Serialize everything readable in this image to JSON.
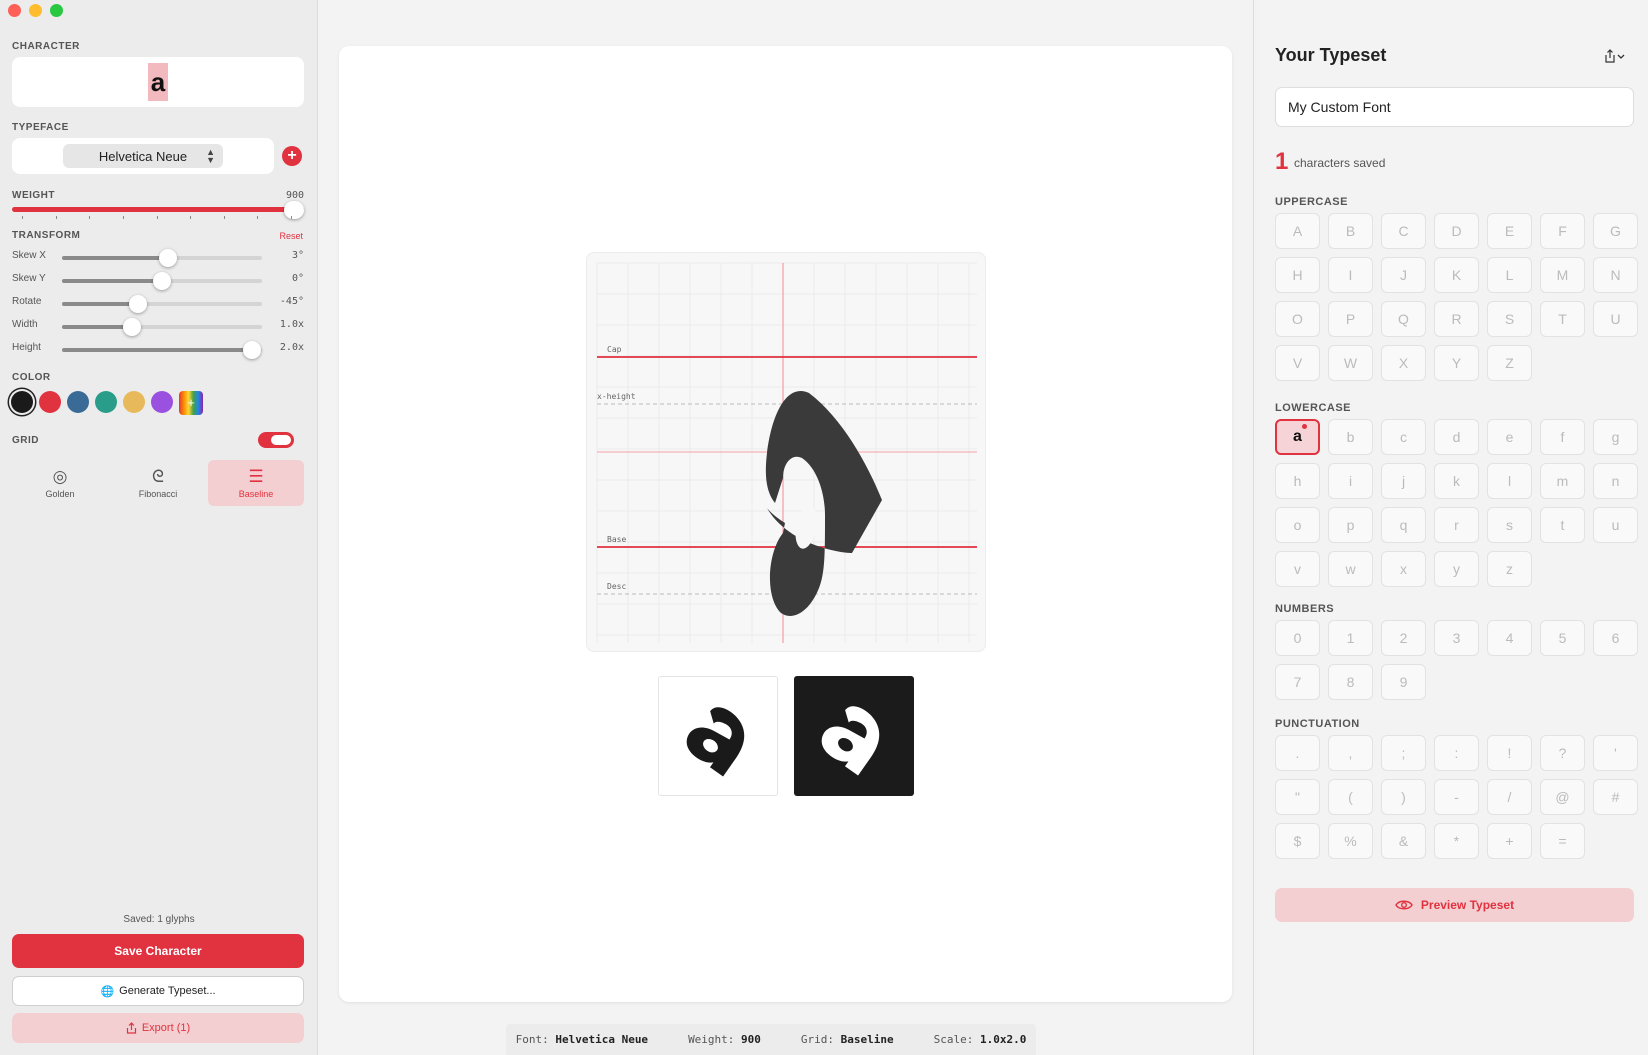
{
  "sidebar": {
    "character_label": "CHARACTER",
    "character": "a",
    "typeface_label": "TYPEFACE",
    "typeface": "Helvetica Neue",
    "add_typeface": "+",
    "weight_label": "WEIGHT",
    "weight_value": "900",
    "transform_label": "TRANSFORM",
    "reset_label": "Reset",
    "sliders": [
      {
        "label": "Skew X",
        "value": "3°",
        "fraction": 0.53
      },
      {
        "label": "Skew Y",
        "value": "0°",
        "fraction": 0.5
      },
      {
        "label": "Rotate",
        "value": "-45°",
        "fraction": 0.38
      },
      {
        "label": "Width",
        "value": "1.0x",
        "fraction": 0.35
      },
      {
        "label": "Height",
        "value": "2.0x",
        "fraction": 0.95
      }
    ],
    "color_label": "COLOR",
    "colors": [
      "#1a1a1a",
      "#e0323f",
      "#3a6b96",
      "#2a9d8a",
      "#e8b95a",
      "#9b51e0"
    ],
    "color_custom": "+",
    "grid_label": "GRID",
    "grid_enabled": true,
    "grid_options": [
      {
        "label": "Golden",
        "icon": "golden-ratio-icon",
        "glyph": "◎",
        "active": false
      },
      {
        "label": "Fibonacci",
        "icon": "fibonacci-spiral-icon",
        "glyph": "ᘓ",
        "active": false
      },
      {
        "label": "Baseline",
        "icon": "baseline-lines-icon",
        "glyph": "☰",
        "active": true
      }
    ],
    "saved_count": "Saved: 1 glyphs",
    "save_button": "Save Character",
    "generate_button": "Generate Typeset...",
    "export_button": "Export (1)"
  },
  "canvas": {
    "guides": {
      "cap": "Cap",
      "xheight": "x-height",
      "base": "Base",
      "desc": "Desc"
    }
  },
  "status": {
    "font_label": "Font:",
    "font": "Helvetica Neue",
    "weight_label": "Weight:",
    "weight": "900",
    "grid_label": "Grid:",
    "grid": "Baseline",
    "scale_label": "Scale:",
    "scale": "1.0x2.0"
  },
  "typeset": {
    "title": "Your Typeset",
    "name": "My Custom Font",
    "count": "1",
    "count_text": "characters saved",
    "groups": [
      {
        "label": "UPPERCASE",
        "chars": [
          "A",
          "B",
          "C",
          "D",
          "E",
          "F",
          "G",
          "H",
          "I",
          "J",
          "K",
          "L",
          "M",
          "N",
          "O",
          "P",
          "Q",
          "R",
          "S",
          "T",
          "U",
          "V",
          "W",
          "X",
          "Y",
          "Z"
        ]
      },
      {
        "label": "LOWERCASE",
        "chars": [
          "a",
          "b",
          "c",
          "d",
          "e",
          "f",
          "g",
          "h",
          "i",
          "j",
          "k",
          "l",
          "m",
          "n",
          "o",
          "p",
          "q",
          "r",
          "s",
          "t",
          "u",
          "v",
          "w",
          "x",
          "y",
          "z"
        ]
      },
      {
        "label": "NUMBERS",
        "chars": [
          "0",
          "1",
          "2",
          "3",
          "4",
          "5",
          "6",
          "7",
          "8",
          "9"
        ]
      },
      {
        "label": "PUNCTUATION",
        "chars": [
          ".",
          ",",
          ";",
          ":",
          "!",
          "?",
          "'",
          "\"",
          "(",
          ")",
          "-",
          "/",
          "@",
          "#",
          "$",
          "%",
          "&",
          "*",
          "+",
          "="
        ]
      }
    ],
    "filled": [
      "a"
    ],
    "preview_button": "Preview Typeset"
  }
}
